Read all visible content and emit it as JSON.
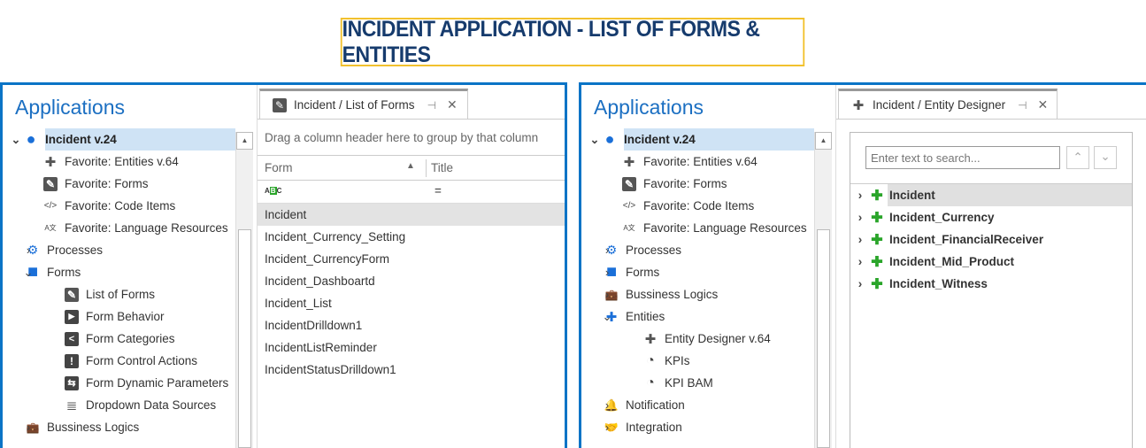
{
  "title": "INCIDENT APPLICATION - LIST OF FORMS & ENTITIES",
  "left": {
    "apps_heading": "Applications",
    "tree": [
      {
        "label": "Incident v.24",
        "icon": "circle-icon",
        "level": 0,
        "chev": "v",
        "sel": true
      },
      {
        "label": "Favorite: Entities v.64",
        "icon": "puzzle-icon",
        "level": 1
      },
      {
        "label": "Favorite: Forms",
        "icon": "pencil-icon",
        "level": 1
      },
      {
        "label": "Favorite: Code Items",
        "icon": "code-icon",
        "level": 1
      },
      {
        "label": "Favorite: Language Resources",
        "icon": "language-icon",
        "level": 1
      },
      {
        "label": "Processes",
        "icon": "gears-icon",
        "level": 0,
        "chev": ">"
      },
      {
        "label": "Forms",
        "icon": "square-icon",
        "level": 0,
        "chev": "v"
      },
      {
        "label": "List of Forms",
        "icon": "pencil-icon",
        "level": 2
      },
      {
        "label": "Form Behavior",
        "icon": "play-icon",
        "level": 2
      },
      {
        "label": "Form Categories",
        "icon": "share-icon",
        "level": 2
      },
      {
        "label": "Form Control Actions",
        "icon": "exclamation-icon",
        "level": 2
      },
      {
        "label": "Form Dynamic Parameters",
        "icon": "sliders-icon",
        "level": 2
      },
      {
        "label": "Dropdown Data Sources",
        "icon": "database-icon",
        "level": 2
      },
      {
        "label": "Bussiness Logics",
        "icon": "briefcase-icon",
        "level": 0,
        "chev": ">"
      }
    ],
    "tab": {
      "label": "Incident / List of Forms",
      "icon": "pencil-icon"
    },
    "group_hint": "Drag a column header here to group by that column",
    "columns": [
      "Form",
      "Title"
    ],
    "filter_icon": "abc-filter-icon",
    "filter_title": "=",
    "rows": [
      "Incident",
      "Incident_Currency_Setting",
      "Incident_CurrencyForm",
      "Incident_Dashboartd",
      "Incident_List",
      "IncidentDrilldown1",
      "IncidentListReminder",
      "IncidentStatusDrilldown1"
    ]
  },
  "right": {
    "apps_heading": "Applications",
    "tree": [
      {
        "label": "Incident v.24",
        "icon": "circle-icon",
        "level": 0,
        "chev": "v",
        "sel": true
      },
      {
        "label": "Favorite: Entities v.64",
        "icon": "puzzle-icon",
        "level": 1
      },
      {
        "label": "Favorite: Forms",
        "icon": "pencil-icon",
        "level": 1
      },
      {
        "label": "Favorite: Code Items",
        "icon": "code-icon",
        "level": 1
      },
      {
        "label": "Favorite: Language Resources",
        "icon": "language-icon",
        "level": 1
      },
      {
        "label": "Processes",
        "icon": "gears-icon",
        "level": 0,
        "chev": ">"
      },
      {
        "label": "Forms",
        "icon": "square-icon",
        "level": 0,
        "chev": ">"
      },
      {
        "label": "Bussiness Logics",
        "icon": "briefcase-icon",
        "level": 0,
        "chev": ">"
      },
      {
        "label": "Entities",
        "icon": "puzzle-blue-icon",
        "level": 0,
        "chev": "v"
      },
      {
        "label": "Entity Designer v.64",
        "icon": "puzzle-icon",
        "level": 2
      },
      {
        "label": "KPIs",
        "icon": "pie-icon",
        "level": 2
      },
      {
        "label": "KPI BAM",
        "icon": "pie-icon",
        "level": 2
      },
      {
        "label": "Notification",
        "icon": "bell-icon",
        "level": 0,
        "chev": ">"
      },
      {
        "label": "Integration",
        "icon": "handshake-icon",
        "level": 0,
        "chev": ">"
      }
    ],
    "tab": {
      "label": "Incident / Entity Designer",
      "icon": "puzzle-icon"
    },
    "search_placeholder": "Enter text to search...",
    "entities": [
      "Incident",
      "Incident_Currency",
      "Incident_FinancialReceiver",
      "Incident_Mid_Product",
      "Incident_Witness"
    ]
  },
  "colors": {
    "accent": "#0b74c6",
    "title_border": "#f2c12e",
    "title_text": "#163b6d",
    "entity_green": "#2aa52a",
    "selection": "#cfe3f5"
  }
}
